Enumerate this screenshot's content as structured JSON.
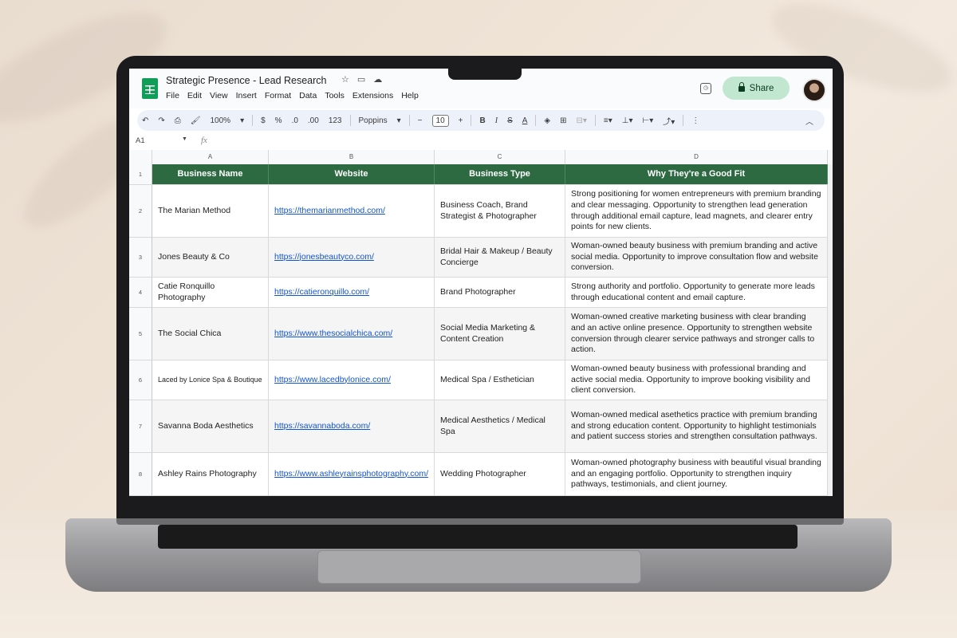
{
  "document": {
    "title": "Strategic Presence - Lead Research",
    "menu": [
      "File",
      "Edit",
      "View",
      "Insert",
      "Format",
      "Data",
      "Tools",
      "Extensions",
      "Help"
    ],
    "share_label": "Share"
  },
  "toolbar": {
    "zoom": "100%",
    "currency": "$",
    "percent": "%",
    "dec_decrease": ".0",
    "dec_increase": ".00",
    "number_format": "123",
    "font": "Poppins",
    "font_size": "10",
    "bold": "B",
    "italic": "I",
    "strike": "S",
    "text_color": "A"
  },
  "formula_bar": {
    "cell_ref": "A1",
    "fx": "fx"
  },
  "columns": [
    "A",
    "B",
    "C",
    "D"
  ],
  "headers": [
    "Business Name",
    "Website",
    "Business Type",
    "Why They're a Good Fit"
  ],
  "rows": [
    {
      "n": "2",
      "name": "The Marian Method",
      "site": "https://themarianmethod.com/",
      "type": "Business Coach, Brand Strategist & Photographer",
      "why": "Strong positioning for women entrepreneurs with premium branding and clear messaging. Opportunity to strengthen lead generation through additional email capture, lead magnets, and clearer entry points for new clients."
    },
    {
      "n": "3",
      "name": "Jones Beauty & Co",
      "site": "https://jonesbeautyco.com/",
      "type": "Bridal Hair & Makeup / Beauty Concierge",
      "why": "Woman-owned beauty business with premium branding and active social media. Opportunity to improve consultation flow and website conversion."
    },
    {
      "n": "4",
      "name": "Catie Ronquillo Photography",
      "site": "https://catieronquillo.com/",
      "type": "Brand Photographer",
      "why": "Strong authority and portfolio. Opportunity to generate more leads through educational content and email capture."
    },
    {
      "n": "5",
      "name": "The Social Chica",
      "site": "https://www.thesocialchica.com/",
      "type": "Social Media Marketing & Content Creation",
      "why": "Woman-owned creative marketing business with clear branding and an active online presence. Opportunity to strengthen website conversion through clearer service pathways and stronger calls to action."
    },
    {
      "n": "6",
      "name": "Laced by Lonice Spa & Boutique",
      "site": "https://www.lacedbylonice.com/",
      "type": "Medical Spa / Esthetician",
      "why": "Woman-owned beauty business with professional branding and active social media. Opportunity to improve booking visibility and client conversion."
    },
    {
      "n": "7",
      "name": "Savanna Boda Aesthetics",
      "site": "https://savannaboda.com/",
      "type": "Medical Aesthetics / Medical Spa",
      "why": "Woman-owned medical asethetics practice with premium branding and strong education content. Opportunity to highlight testimonials and patient success stories and strengthen consultation pathways."
    },
    {
      "n": "8",
      "name": "Ashley Rains Photography",
      "site": "https://www.ashleyrainsphotography.com/",
      "type": "Wedding Photographer",
      "why": "Woman-owned photography business with beautiful visual branding and an engaging portfolio. Opportunity to strengthen inquiry pathways, testimonials, and client journey."
    }
  ],
  "header_row_number": "1",
  "colors": {
    "header_green": "#2d6a42",
    "share_bg": "#c2e7d0",
    "link": "#1155cc"
  }
}
